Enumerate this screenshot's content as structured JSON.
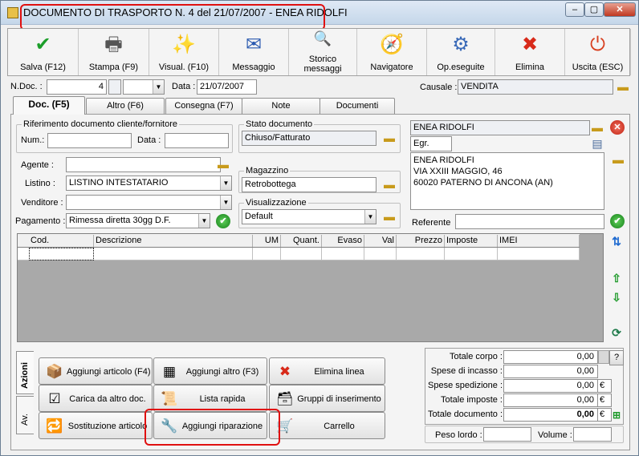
{
  "window": {
    "title": "DOCUMENTO DI TRASPORTO N. 4  del 21/07/2007 - ENEA RIDOLFI",
    "min_label": "–",
    "max_label": "▢",
    "close_label": "✕"
  },
  "toolbar": [
    {
      "label": "Salva (F12)",
      "icon": "save-check-icon",
      "glyph": "✔",
      "color": "#1c9e2a"
    },
    {
      "label": "Stampa (F9)",
      "icon": "printer-icon",
      "glyph": "🖶",
      "color": "#555"
    },
    {
      "label": "Visual. (F10)",
      "icon": "magic-wand-icon",
      "glyph": "✨",
      "color": "#c08a10"
    },
    {
      "label": "Messaggio",
      "icon": "pen-message-icon",
      "glyph": "✉",
      "color": "#2a5ab0"
    },
    {
      "label": "Storico messaggi",
      "icon": "message-history-icon",
      "glyph": "🔍",
      "color": "#2a5ab0"
    },
    {
      "label": "Navigatore",
      "icon": "compass-icon",
      "glyph": "🧭",
      "color": "#a02a2a"
    },
    {
      "label": "Op.eseguite",
      "icon": "gears-icon",
      "glyph": "⚙",
      "color": "#3a6ab8"
    },
    {
      "label": "Elimina",
      "icon": "delete-x-icon",
      "glyph": "✖",
      "color": "#d82a1a"
    },
    {
      "label": "Uscita (ESC)",
      "icon": "exit-icon",
      "glyph": "⏻",
      "color": "#d84020"
    }
  ],
  "header": {
    "ndoc_label": "N.Doc. :",
    "ndoc_value": "4",
    "data_label": "Data :",
    "data_value": "21/07/2007",
    "causale_label": "Causale :",
    "causale_value": "VENDITA"
  },
  "tabs": [
    "Doc. (F5)",
    "Altro (F6)",
    "Consegna (F7)",
    "Note",
    "Documenti"
  ],
  "rif": {
    "group_label": "Riferimento documento cliente/fornitore",
    "num_label": "Num.:",
    "num_value": "",
    "data_label": "Data :",
    "data_value": ""
  },
  "stato": {
    "group_label": "Stato documento",
    "value": "Chiuso/Fatturato"
  },
  "magazzino": {
    "group_label": "Magazzino",
    "value": "Retrobottega"
  },
  "visualizzazione": {
    "group_label": "Visualizzazione",
    "value": "Default"
  },
  "fields": {
    "agente_label": "Agente :",
    "agente_value": "",
    "listino_label": "Listino :",
    "listino_value": "LISTINO INTESTATARIO",
    "venditore_label": "Venditore :",
    "venditore_value": "",
    "pagamento_label": "Pagamento :",
    "pagamento_value": "Rimessa diretta 30gg D.F."
  },
  "cliente": {
    "name": "ENEA RIDOLFI",
    "title": "Egr.",
    "address_lines": [
      "ENEA RIDOLFI",
      "VIA XXIII MAGGIO, 46",
      "60020 PATERNO DI ANCONA (AN)"
    ],
    "referente_label": "Referente",
    "referente_value": ""
  },
  "grid": {
    "columns": [
      "Cod.",
      "Descrizione",
      "UM",
      "Quant.",
      "Evaso",
      "Val",
      "Prezzo",
      "Imposte",
      "IMEI"
    ]
  },
  "actions_tabs": [
    "Azioni",
    "Av."
  ],
  "actions": [
    {
      "label": "Aggiungi articolo (F4)",
      "icon": "add-article-icon",
      "glyph": "📦"
    },
    {
      "label": "Aggiungi altro (F3)",
      "icon": "add-other-icon",
      "glyph": "▦"
    },
    {
      "label": "Elimina linea",
      "icon": "delete-line-icon",
      "glyph": "✖"
    },
    {
      "label": "Carica da altro doc.",
      "icon": "load-document-icon",
      "glyph": "☑"
    },
    {
      "label": "Lista rapida",
      "icon": "quick-list-icon",
      "glyph": "📜"
    },
    {
      "label": "Gruppi di inserimento",
      "icon": "insertion-groups-icon",
      "glyph": "🗃"
    },
    {
      "label": "Sostituzione articolo",
      "icon": "replace-article-icon",
      "glyph": "🔁"
    },
    {
      "label": "Aggiungi riparazione",
      "icon": "wrench-icon",
      "glyph": "🔧"
    },
    {
      "label": "Carrello",
      "icon": "cart-icon",
      "glyph": "🛒"
    }
  ],
  "totals": [
    {
      "label": "Totale corpo :",
      "value": "0,00",
      "unit": ""
    },
    {
      "label": "Spese di incasso :",
      "value": "0,00",
      "unit": ""
    },
    {
      "label": "Spese spedizione :",
      "value": "0,00",
      "unit": "€"
    },
    {
      "label": "Totale imposte :",
      "value": "0,00",
      "unit": "€"
    },
    {
      "label": "Totale documento :",
      "value": "0,00",
      "unit": "€"
    }
  ],
  "help_label": "?",
  "weights": {
    "peso_label": "Peso lordo :",
    "peso_value": "",
    "volume_label": "Volume :",
    "volume_value": ""
  }
}
